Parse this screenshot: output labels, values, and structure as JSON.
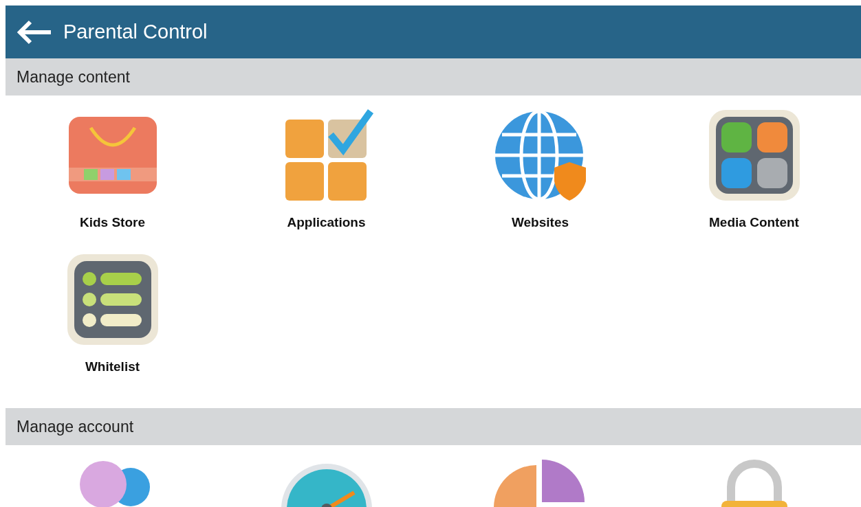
{
  "header": {
    "title": "Parental Control"
  },
  "sections": [
    {
      "title": "Manage content",
      "items": [
        {
          "kind": "store",
          "label": "Kids Store"
        },
        {
          "kind": "apps",
          "label": "Applications"
        },
        {
          "kind": "web",
          "label": "Websites"
        },
        {
          "kind": "media",
          "label": "Media Content"
        },
        {
          "kind": "list",
          "label": "Whitelist"
        }
      ]
    },
    {
      "title": "Manage account",
      "items": [
        {
          "kind": "users"
        },
        {
          "kind": "timer"
        },
        {
          "kind": "chart"
        },
        {
          "kind": "lock"
        }
      ]
    }
  ]
}
